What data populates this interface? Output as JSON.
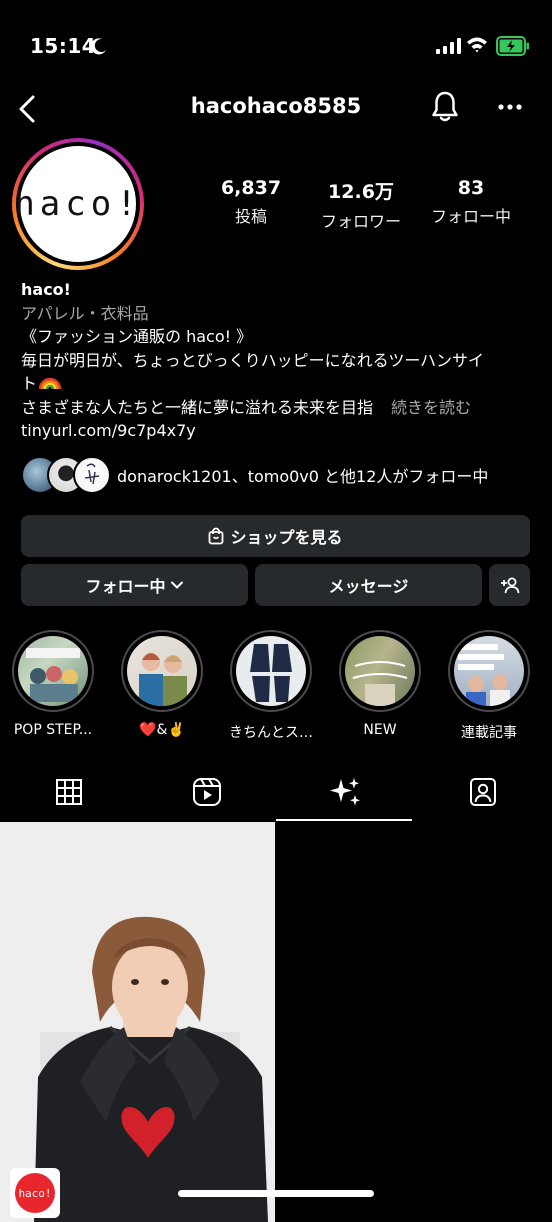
{
  "status_bar": {
    "time": "15:14"
  },
  "header": {
    "username": "hacohaco8585"
  },
  "profile": {
    "avatar_text": "haco!",
    "stats": [
      {
        "value": "6,837",
        "label": "投稿"
      },
      {
        "value": "12.6万",
        "label": "フォロワー"
      },
      {
        "value": "83",
        "label": "フォロー中"
      }
    ],
    "name": "haco!",
    "category": "アパレル・衣料品",
    "bio_lines": [
      "《ファッション通販の haco! 》",
      "毎日が明日が、ちょっとびっくりハッピーになれるツーハンサイ",
      "ト",
      "さまざまな人たちと一緒に夢に溢れる未来を目指"
    ],
    "more_label": "続きを読む",
    "link": "tinyurl.com/9c7p4x7y",
    "followed_by": "donarock1201、tomo0v0 と他12人がフォロー中"
  },
  "buttons": {
    "shop": "ショップを見る",
    "following": "フォロー中",
    "message": "メッセージ"
  },
  "highlights": [
    {
      "label": "POP STEP..."
    },
    {
      "label": "❤️&✌️"
    },
    {
      "label": "きちんとス…"
    },
    {
      "label": "NEW"
    },
    {
      "label": "連載記事"
    }
  ],
  "post": {
    "badge_text": "haco!"
  },
  "colors": {
    "background": "#000000",
    "button": "#262a2d",
    "secondary_text": "#a8a8a8",
    "battery": "#34c759"
  }
}
